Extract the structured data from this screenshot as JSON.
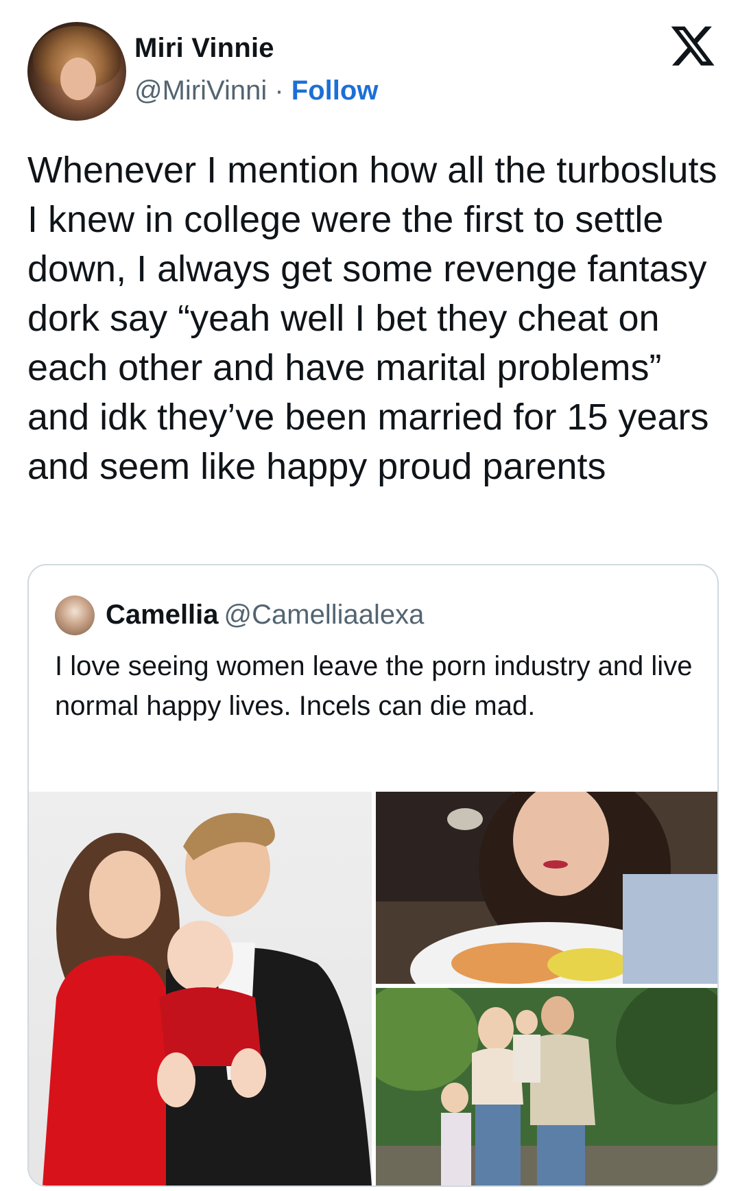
{
  "tweet": {
    "author_name": "Miri Vinnie",
    "author_handle": "@MiriVinni",
    "separator": " · ",
    "follow_label": "Follow",
    "text": "Whenever I mention how all the turbosluts I knew in college were the first to settle down, I always get some revenge fantasy dork say “yeah well I bet they cheat on each other and have marital problems” and idk they’ve been married for 15 years and seem like happy proud parents"
  },
  "quoted_tweet": {
    "author_name": "Camellia",
    "author_handle": "@Camelliaalexa",
    "text": "I love seeing women leave the porn industry and live normal happy lives. Incels can die mad.",
    "images": [
      "family-portrait-photo",
      "dinner-selfie-photo",
      "family-outdoor-photo"
    ]
  },
  "icons": {
    "platform_logo": "x-logo-icon"
  },
  "colors": {
    "follow": "#1d6fd6",
    "secondary_text": "#536471",
    "border": "#cfd9de"
  }
}
